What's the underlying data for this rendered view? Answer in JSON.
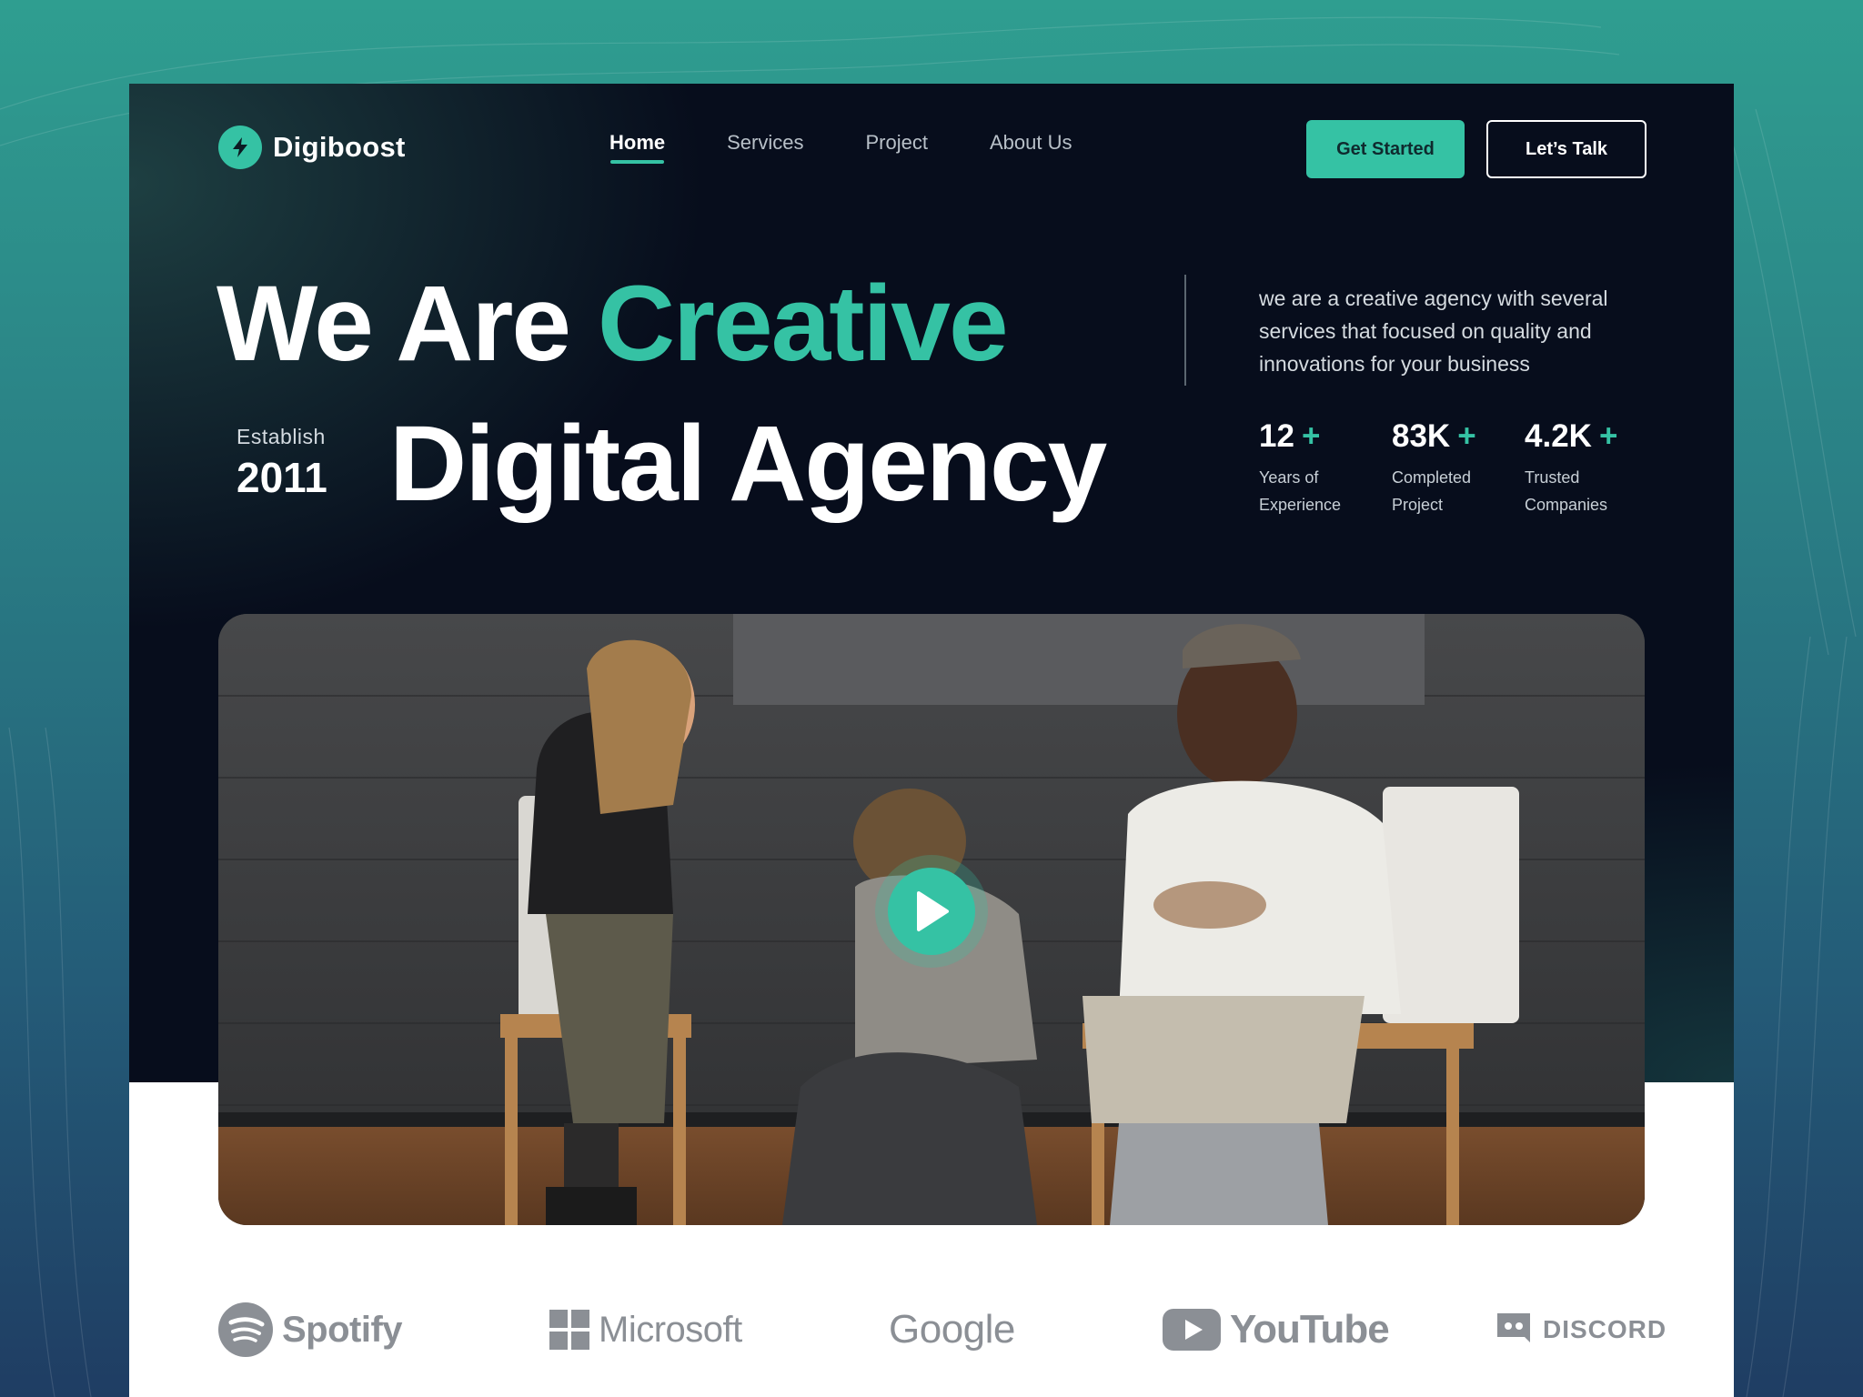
{
  "logo": {
    "name": "Digiboost",
    "icon": "lightning-icon"
  },
  "nav": {
    "items": [
      {
        "label": "Home",
        "active": true
      },
      {
        "label": "Services",
        "active": false
      },
      {
        "label": "Project",
        "active": false
      },
      {
        "label": "About Us",
        "active": false
      }
    ]
  },
  "actions": {
    "get_started": "Get Started",
    "lets_talk": "Let’s Talk"
  },
  "hero": {
    "line1_prefix": "We Are",
    "line1_accent": "Creative",
    "line2": "Digital Agency",
    "establish_label": "Establish",
    "establish_year": "2011",
    "description": "we are a creative agency with several services that focused on quality and innovations for your business",
    "stats": [
      {
        "value": "12",
        "suffix": "+",
        "label_line1": "Years of",
        "label_line2": "Experience"
      },
      {
        "value": "83K",
        "suffix": "+",
        "label_line1": "Completed",
        "label_line2": "Project"
      },
      {
        "value": "4.2K",
        "suffix": "+",
        "label_line1": "Trusted",
        "label_line2": "Companies"
      }
    ]
  },
  "video": {
    "play_icon": "play-icon"
  },
  "brands": [
    {
      "name": "Spotify",
      "icon": "spotify-icon"
    },
    {
      "name": "Microsoft",
      "icon": "microsoft-icon"
    },
    {
      "name": "Google",
      "icon": ""
    },
    {
      "name": "YouTube",
      "icon": "youtube-icon"
    },
    {
      "name": "DISCORD",
      "icon": "discord-icon"
    }
  ],
  "colors": {
    "accent": "#35c2a4",
    "hero_bg": "#070d1c",
    "brand_gray": "#8b8f95"
  }
}
